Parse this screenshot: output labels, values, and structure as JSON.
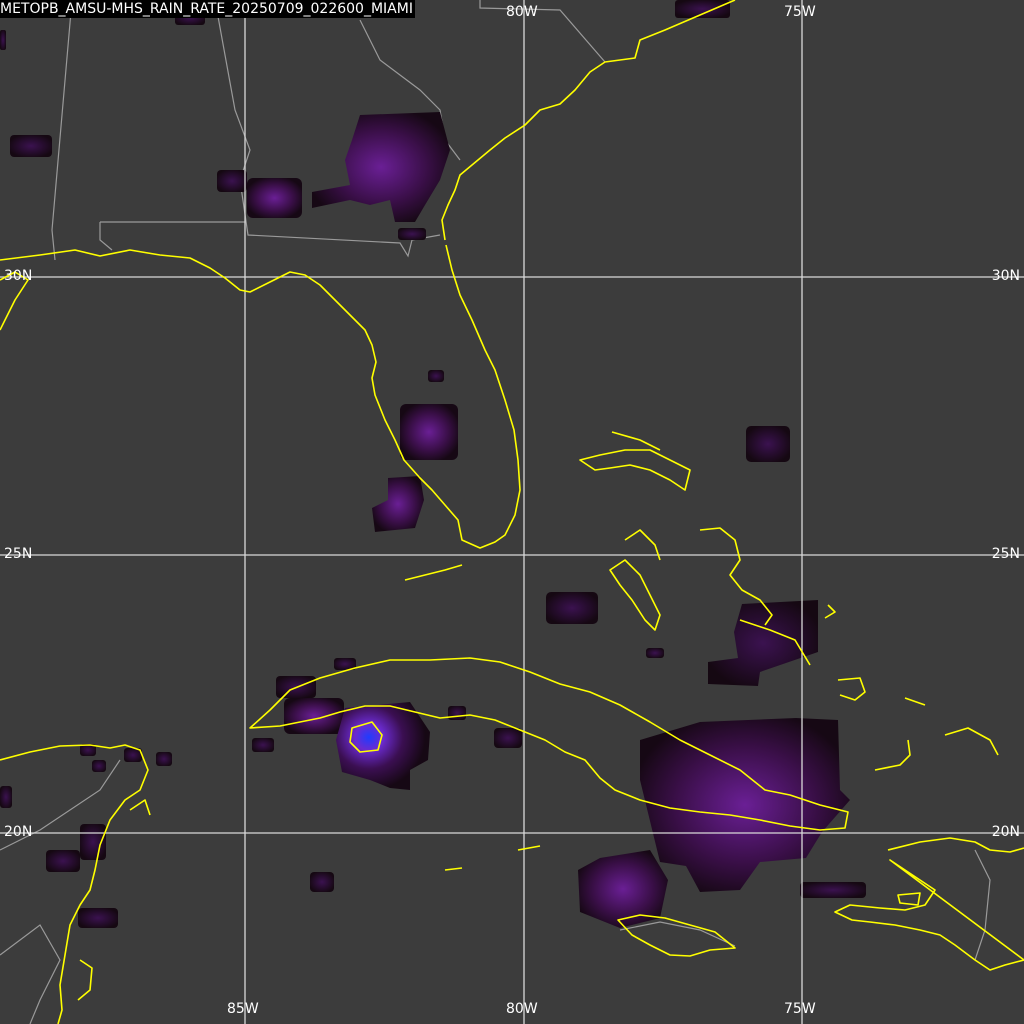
{
  "title": "METOPB_AMSU-MHS_RAIN_RATE_20250709_022600_MIAMI",
  "grid": {
    "lon_top": [
      "80W",
      "75W"
    ],
    "lon_bottom": [
      "85W",
      "80W",
      "75W"
    ],
    "lat_left": [
      "30N",
      "25N",
      "20N"
    ],
    "lat_right": [
      "30N",
      "25N",
      "20N"
    ]
  },
  "colors": {
    "background": "#3c3c3c",
    "grid": "#d9d9d9",
    "coastline": "#ffff00",
    "borders": "#9a9a9a",
    "rain_low": "#1a0a1a",
    "rain_mid": "#5a1a7a",
    "rain_high": "#1f3cff"
  }
}
